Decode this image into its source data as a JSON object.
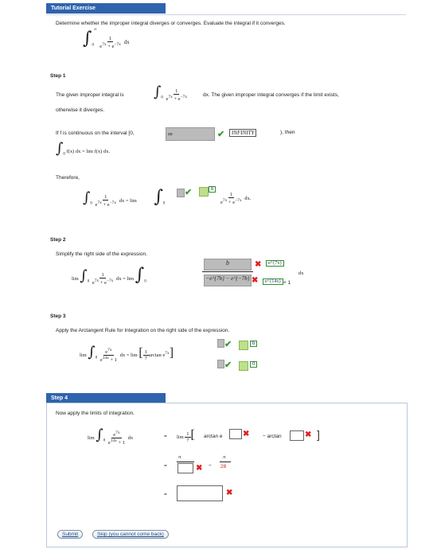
{
  "header": {
    "title": "Tutorial Exercise"
  },
  "problem": {
    "text": "Determine whether the improper integral diverges or converges. Evaluate the integral if it converges."
  },
  "step1": {
    "label": "Step 1",
    "line1a": "The given improper integral is",
    "line1b": "dx. The given improper integral converges if the limit exists,",
    "line1c": "otherwise it diverges.",
    "cont_text": "If f is continuous on the interval [0,",
    "cont_input": "∞",
    "cont_answer": "INFINITY",
    "cont_after": "), then",
    "limit_formula": "f(x) dx  =  lim    f(x) dx.",
    "therefore": "Therefore,",
    "b_box": "b"
  },
  "step2": {
    "label": "Step 2",
    "text": "Simplify the right side of the expression.",
    "num_box": "b",
    "den_box": "−e^{7b} − e^{−7b}",
    "ans1": "e^{7x}",
    "ans2": "e^{14x}",
    "plus_one": "+ 1"
  },
  "step3": {
    "label": "Step 3",
    "text": "Apply the Arctangent Rule for Integration on the right side of the expression.",
    "upper_ans": "b",
    "lower_ans": "0"
  },
  "step4": {
    "label": "Step 4",
    "text": "Now apply the limits of integration.",
    "arctan1": "arctan e",
    "minus_arctan": "− arctan",
    "denominator_28": "28",
    "pi": "π"
  },
  "buttons": {
    "submit": "Submit",
    "skip": "Skip (you cannot come back)"
  }
}
